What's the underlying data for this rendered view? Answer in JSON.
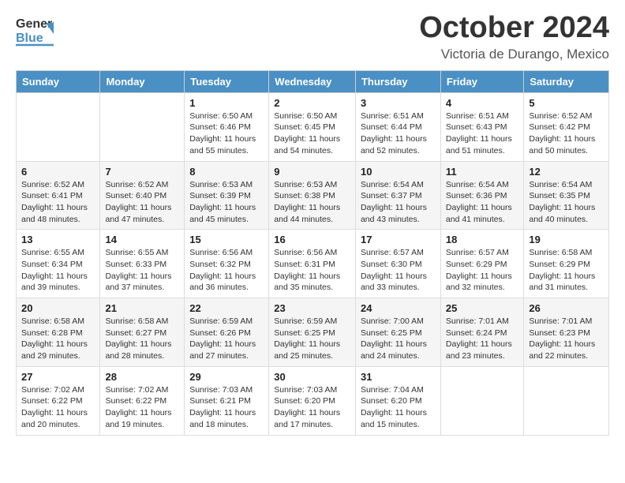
{
  "header": {
    "logo_general": "General",
    "logo_blue": "Blue",
    "month_title": "October 2024",
    "location": "Victoria de Durango, Mexico"
  },
  "days_of_week": [
    "Sunday",
    "Monday",
    "Tuesday",
    "Wednesday",
    "Thursday",
    "Friday",
    "Saturday"
  ],
  "weeks": [
    [
      {
        "day": "",
        "info": ""
      },
      {
        "day": "",
        "info": ""
      },
      {
        "day": "1",
        "info": "Sunrise: 6:50 AM\nSunset: 6:46 PM\nDaylight: 11 hours and 55 minutes."
      },
      {
        "day": "2",
        "info": "Sunrise: 6:50 AM\nSunset: 6:45 PM\nDaylight: 11 hours and 54 minutes."
      },
      {
        "day": "3",
        "info": "Sunrise: 6:51 AM\nSunset: 6:44 PM\nDaylight: 11 hours and 52 minutes."
      },
      {
        "day": "4",
        "info": "Sunrise: 6:51 AM\nSunset: 6:43 PM\nDaylight: 11 hours and 51 minutes."
      },
      {
        "day": "5",
        "info": "Sunrise: 6:52 AM\nSunset: 6:42 PM\nDaylight: 11 hours and 50 minutes."
      }
    ],
    [
      {
        "day": "6",
        "info": "Sunrise: 6:52 AM\nSunset: 6:41 PM\nDaylight: 11 hours and 48 minutes."
      },
      {
        "day": "7",
        "info": "Sunrise: 6:52 AM\nSunset: 6:40 PM\nDaylight: 11 hours and 47 minutes."
      },
      {
        "day": "8",
        "info": "Sunrise: 6:53 AM\nSunset: 6:39 PM\nDaylight: 11 hours and 45 minutes."
      },
      {
        "day": "9",
        "info": "Sunrise: 6:53 AM\nSunset: 6:38 PM\nDaylight: 11 hours and 44 minutes."
      },
      {
        "day": "10",
        "info": "Sunrise: 6:54 AM\nSunset: 6:37 PM\nDaylight: 11 hours and 43 minutes."
      },
      {
        "day": "11",
        "info": "Sunrise: 6:54 AM\nSunset: 6:36 PM\nDaylight: 11 hours and 41 minutes."
      },
      {
        "day": "12",
        "info": "Sunrise: 6:54 AM\nSunset: 6:35 PM\nDaylight: 11 hours and 40 minutes."
      }
    ],
    [
      {
        "day": "13",
        "info": "Sunrise: 6:55 AM\nSunset: 6:34 PM\nDaylight: 11 hours and 39 minutes."
      },
      {
        "day": "14",
        "info": "Sunrise: 6:55 AM\nSunset: 6:33 PM\nDaylight: 11 hours and 37 minutes."
      },
      {
        "day": "15",
        "info": "Sunrise: 6:56 AM\nSunset: 6:32 PM\nDaylight: 11 hours and 36 minutes."
      },
      {
        "day": "16",
        "info": "Sunrise: 6:56 AM\nSunset: 6:31 PM\nDaylight: 11 hours and 35 minutes."
      },
      {
        "day": "17",
        "info": "Sunrise: 6:57 AM\nSunset: 6:30 PM\nDaylight: 11 hours and 33 minutes."
      },
      {
        "day": "18",
        "info": "Sunrise: 6:57 AM\nSunset: 6:29 PM\nDaylight: 11 hours and 32 minutes."
      },
      {
        "day": "19",
        "info": "Sunrise: 6:58 AM\nSunset: 6:29 PM\nDaylight: 11 hours and 31 minutes."
      }
    ],
    [
      {
        "day": "20",
        "info": "Sunrise: 6:58 AM\nSunset: 6:28 PM\nDaylight: 11 hours and 29 minutes."
      },
      {
        "day": "21",
        "info": "Sunrise: 6:58 AM\nSunset: 6:27 PM\nDaylight: 11 hours and 28 minutes."
      },
      {
        "day": "22",
        "info": "Sunrise: 6:59 AM\nSunset: 6:26 PM\nDaylight: 11 hours and 27 minutes."
      },
      {
        "day": "23",
        "info": "Sunrise: 6:59 AM\nSunset: 6:25 PM\nDaylight: 11 hours and 25 minutes."
      },
      {
        "day": "24",
        "info": "Sunrise: 7:00 AM\nSunset: 6:25 PM\nDaylight: 11 hours and 24 minutes."
      },
      {
        "day": "25",
        "info": "Sunrise: 7:01 AM\nSunset: 6:24 PM\nDaylight: 11 hours and 23 minutes."
      },
      {
        "day": "26",
        "info": "Sunrise: 7:01 AM\nSunset: 6:23 PM\nDaylight: 11 hours and 22 minutes."
      }
    ],
    [
      {
        "day": "27",
        "info": "Sunrise: 7:02 AM\nSunset: 6:22 PM\nDaylight: 11 hours and 20 minutes."
      },
      {
        "day": "28",
        "info": "Sunrise: 7:02 AM\nSunset: 6:22 PM\nDaylight: 11 hours and 19 minutes."
      },
      {
        "day": "29",
        "info": "Sunrise: 7:03 AM\nSunset: 6:21 PM\nDaylight: 11 hours and 18 minutes."
      },
      {
        "day": "30",
        "info": "Sunrise: 7:03 AM\nSunset: 6:20 PM\nDaylight: 11 hours and 17 minutes."
      },
      {
        "day": "31",
        "info": "Sunrise: 7:04 AM\nSunset: 6:20 PM\nDaylight: 11 hours and 15 minutes."
      },
      {
        "day": "",
        "info": ""
      },
      {
        "day": "",
        "info": ""
      }
    ]
  ]
}
